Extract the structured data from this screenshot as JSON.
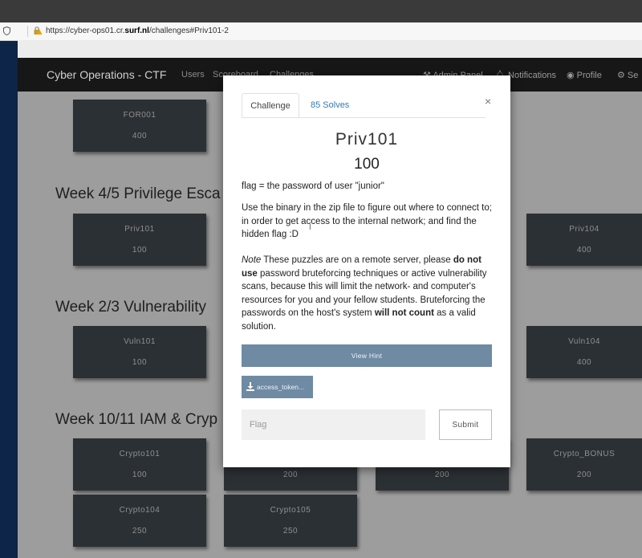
{
  "browser": {
    "url_prefix": "https://cyber-ops01.cr.",
    "url_domain": "surf.nl",
    "url_path": "/challenges#Priv101-2"
  },
  "navbar": {
    "brand": "Cyber Operations - CTF",
    "links": [
      "Users",
      "Scoreboard",
      "Challenges"
    ],
    "right": {
      "admin": "Admin Panel",
      "notifications": "Notifications",
      "profile": "Profile",
      "settings": "Se"
    }
  },
  "sections": [
    {
      "title": "Week 4/5 Privilege Esca"
    },
    {
      "title": "Week 2/3 Vulnerability"
    },
    {
      "title": "Week 10/11 IAM & Cryp"
    }
  ],
  "tiles": [
    {
      "name": "FOR001",
      "value": "400"
    },
    {
      "name": "Priv101",
      "value": "100"
    },
    {
      "name": "Priv104",
      "value": "400"
    },
    {
      "name": "Vuln101",
      "value": "100"
    },
    {
      "name": "Vuln104",
      "value": "400"
    },
    {
      "name": "Crypto101",
      "value": "100"
    },
    {
      "name": "",
      "value": "200"
    },
    {
      "name": "",
      "value": "200"
    },
    {
      "name": "Crypto_BONUS",
      "value": "200"
    },
    {
      "name": "Crypto104",
      "value": "250"
    },
    {
      "name": "Crypto105",
      "value": "250"
    }
  ],
  "modal": {
    "tab_challenge": "Challenge",
    "tab_solves": "85 Solves",
    "close": "×",
    "title": "Priv101",
    "value": "100",
    "desc1": "flag = the password of user \"junior\"",
    "desc2": "Use the binary in the zip file to figure out where to connect to; in order to get access to the internal network; and find the hidden flag :D",
    "note_label": "Note",
    "note_part1": " These puzzles are on a remote server, please ",
    "note_bold1": "do not use",
    "note_part2": " password bruteforcing techniques or active vulnerability scans, because this will limit the network- and computer's resources for you and your fellow students. Bruteforcing the passwords on the host's system ",
    "note_bold2": "will not count",
    "note_part3": " as a valid solution.",
    "hint_button": "View Hint",
    "download_button": "access_token...",
    "flag_placeholder": "Flag",
    "submit_button": "Submit"
  }
}
